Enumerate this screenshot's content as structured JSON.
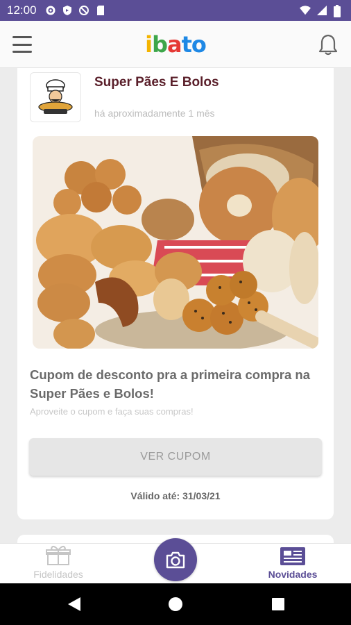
{
  "status_bar": {
    "time": "12:00"
  },
  "app_bar": {
    "logo": [
      "i",
      "b",
      "a",
      "t",
      "o"
    ],
    "logo_colors": [
      "#f4b400",
      "#3da64a",
      "#e53935",
      "#1e88e5",
      "#1e88e5"
    ]
  },
  "post": {
    "store_name": "Super Pães E Bolos",
    "time_ago": "há aproximadamente 1 mês",
    "title": "Cupom de desconto pra a primeira compra na Super Pães e Bolos!",
    "subtitle": "Aproveite o cupom e faça suas compras!",
    "button_label": "VER CUPOM",
    "valid_until": "Válido até: 31/03/21"
  },
  "bottom_nav": {
    "left_label": "Fidelidades",
    "right_label": "Novidades",
    "active_color": "#5b4e96",
    "inactive_color": "#c5c5c5"
  },
  "colors": {
    "primary": "#5b4e96",
    "store_name": "#5a1f2a"
  }
}
